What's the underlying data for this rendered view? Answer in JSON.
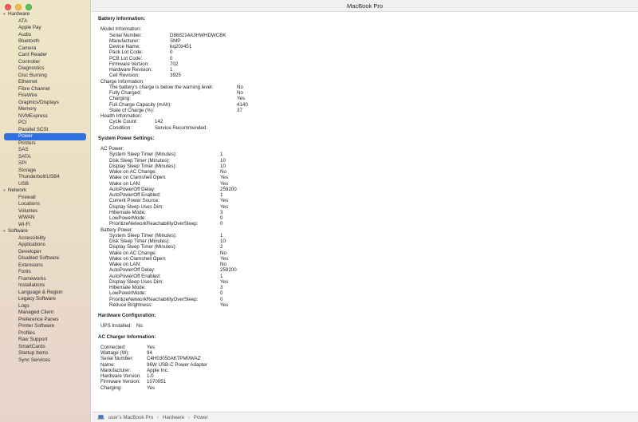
{
  "window": {
    "title": "MacBook Pro"
  },
  "sidebar": {
    "groups": [
      {
        "label": "Hardware",
        "items": [
          "ATA",
          "Apple Pay",
          "Audio",
          "Bluetooth",
          "Camera",
          "Card Reader",
          "Controller",
          "Diagnostics",
          "Disc Burning",
          "Ethernet",
          "Fibre Channel",
          "FireWire",
          "Graphics/Displays",
          "Memory",
          "NVMExpress",
          "PCI",
          "Parallel SCSI",
          "Power",
          "Printers",
          "SAS",
          "SATA",
          "SPI",
          "Storage",
          "Thunderbolt/USB4",
          "USB"
        ]
      },
      {
        "label": "Network",
        "items": [
          "Firewall",
          "Locations",
          "Volumes",
          "WWAN",
          "Wi-Fi"
        ]
      },
      {
        "label": "Software",
        "items": [
          "Accessibility",
          "Applications",
          "Developer",
          "Disabled Software",
          "Extensions",
          "Fonts",
          "Frameworks",
          "Installations",
          "Language & Region",
          "Legacy Software",
          "Logs",
          "Managed Client",
          "Preference Panes",
          "Printer Software",
          "Profiles",
          "Raw Support",
          "SmartCards",
          "Startup Items",
          "Sync Services"
        ]
      }
    ],
    "selected": "Power"
  },
  "content": {
    "sections": [
      {
        "type": "heading",
        "text": "Battery Information:",
        "indent": 0,
        "gap": 0
      },
      {
        "type": "sub",
        "text": "Model Information:",
        "indent": 1,
        "gap": 6
      },
      {
        "type": "kv",
        "key": "Serial Number:",
        "value": "D868214A3HWHDWCBK",
        "indent": 2,
        "col": 76
      },
      {
        "type": "kv",
        "key": "Manufacturer:",
        "value": "SMP",
        "indent": 2,
        "col": 76
      },
      {
        "type": "kv",
        "key": "Device Name:",
        "value": "bq20z451",
        "indent": 2,
        "col": 76
      },
      {
        "type": "kv",
        "key": "Pack Lot Code:",
        "value": "0",
        "indent": 2,
        "col": 76
      },
      {
        "type": "kv",
        "key": "PCB Lot Code:",
        "value": "0",
        "indent": 2,
        "col": 76
      },
      {
        "type": "kv",
        "key": "Firmware Version:",
        "value": "702",
        "indent": 2,
        "col": 76
      },
      {
        "type": "kv",
        "key": "Hardware Revision:",
        "value": "1",
        "indent": 2,
        "col": 76
      },
      {
        "type": "kv",
        "key": "Cell Revision:",
        "value": "3925",
        "indent": 2,
        "col": 76
      },
      {
        "type": "sub",
        "text": "Charge Information:",
        "indent": 1
      },
      {
        "type": "kv",
        "key": "The battery’s charge is below the warning level:",
        "value": "No",
        "indent": 2,
        "col": 160
      },
      {
        "type": "kv",
        "key": "Fully Charged:",
        "value": "No",
        "indent": 2,
        "col": 160
      },
      {
        "type": "kv",
        "key": "Charging:",
        "value": "Yes",
        "indent": 2,
        "col": 160
      },
      {
        "type": "kv",
        "key": "Full Charge Capacity (mAh):",
        "value": "4140",
        "indent": 2,
        "col": 160
      },
      {
        "type": "kv",
        "key": "State of Charge (%):",
        "value": "37",
        "indent": 2,
        "col": 160
      },
      {
        "type": "sub",
        "text": "Health Information:",
        "indent": 1
      },
      {
        "type": "kv",
        "key": "Cycle Count:",
        "value": "142",
        "indent": 2,
        "col": 57
      },
      {
        "type": "kv",
        "key": "Condition:",
        "value": "Service Recommended",
        "indent": 2,
        "col": 57
      },
      {
        "type": "heading",
        "text": "System Power Settings:",
        "indent": 0,
        "gap": 6
      },
      {
        "type": "sub",
        "text": "AC Power:",
        "indent": 1,
        "gap": 6
      },
      {
        "type": "kv",
        "key": "System Sleep Timer (Minutes):",
        "value": "1",
        "indent": 2,
        "col": 139
      },
      {
        "type": "kv",
        "key": "Disk Sleep Timer (Minutes):",
        "value": "10",
        "indent": 2,
        "col": 139
      },
      {
        "type": "kv",
        "key": "Display Sleep Timer (Minutes):",
        "value": "10",
        "indent": 2,
        "col": 139
      },
      {
        "type": "kv",
        "key": "Wake on AC Change:",
        "value": "No",
        "indent": 2,
        "col": 139
      },
      {
        "type": "kv",
        "key": "Wake on Clamshell Open:",
        "value": "Yes",
        "indent": 2,
        "col": 139
      },
      {
        "type": "kv",
        "key": "Wake on LAN:",
        "value": "Yes",
        "indent": 2,
        "col": 139
      },
      {
        "type": "kv",
        "key": "AutoPowerOff Delay:",
        "value": "259200",
        "indent": 2,
        "col": 139
      },
      {
        "type": "kv",
        "key": "AutoPowerOff Enabled:",
        "value": "1",
        "indent": 2,
        "col": 139
      },
      {
        "type": "kv",
        "key": "Current Power Source:",
        "value": "Yes",
        "indent": 2,
        "col": 139
      },
      {
        "type": "kv",
        "key": "Display Sleep Uses Dim:",
        "value": "Yes",
        "indent": 2,
        "col": 139
      },
      {
        "type": "kv",
        "key": "Hibernate Mode:",
        "value": "3",
        "indent": 2,
        "col": 139
      },
      {
        "type": "kv",
        "key": "LowPowerMode:",
        "value": "0",
        "indent": 2,
        "col": 139
      },
      {
        "type": "kv",
        "key": "PrioritizeNetworkReachabilityOverSleep:",
        "value": "0",
        "indent": 2,
        "col": 139
      },
      {
        "type": "sub",
        "text": "Battery Power:",
        "indent": 1
      },
      {
        "type": "kv",
        "key": "System Sleep Timer (Minutes):",
        "value": "1",
        "indent": 2,
        "col": 139
      },
      {
        "type": "kv",
        "key": "Disk Sleep Timer (Minutes):",
        "value": "10",
        "indent": 2,
        "col": 139
      },
      {
        "type": "kv",
        "key": "Display Sleep Timer (Minutes):",
        "value": "2",
        "indent": 2,
        "col": 139
      },
      {
        "type": "kv",
        "key": "Wake on AC Change:",
        "value": "No",
        "indent": 2,
        "col": 139
      },
      {
        "type": "kv",
        "key": "Wake on Clamshell Open:",
        "value": "Yes",
        "indent": 2,
        "col": 139
      },
      {
        "type": "kv",
        "key": "Wake on LAN:",
        "value": "No",
        "indent": 2,
        "col": 139
      },
      {
        "type": "kv",
        "key": "AutoPowerOff Delay:",
        "value": "259200",
        "indent": 2,
        "col": 139
      },
      {
        "type": "kv",
        "key": "AutoPowerOff Enabled:",
        "value": "1",
        "indent": 2,
        "col": 139
      },
      {
        "type": "kv",
        "key": "Display Sleep Uses Dim:",
        "value": "Yes",
        "indent": 2,
        "col": 139
      },
      {
        "type": "kv",
        "key": "Hibernate Mode:",
        "value": "3",
        "indent": 2,
        "col": 139
      },
      {
        "type": "kv",
        "key": "LowPowerMode:",
        "value": "0",
        "indent": 2,
        "col": 139
      },
      {
        "type": "kv",
        "key": "PrioritizeNetworkReachabilityOverSleep:",
        "value": "0",
        "indent": 2,
        "col": 139
      },
      {
        "type": "kv",
        "key": "Reduce Brightness:",
        "value": "Yes",
        "indent": 2,
        "col": 139
      },
      {
        "type": "heading",
        "text": "Hardware Configuration:",
        "indent": 0,
        "gap": 6
      },
      {
        "type": "kv",
        "key": "UPS Installed:",
        "value": "No",
        "indent": 1,
        "col": 45,
        "gap": 6
      },
      {
        "type": "heading",
        "text": "AC Charger Information:",
        "indent": 0,
        "gap": 6
      },
      {
        "type": "kv",
        "key": "Connected:",
        "value": "Yes",
        "indent": 1,
        "col": 58,
        "gap": 6
      },
      {
        "type": "kv",
        "key": "Wattage (W):",
        "value": "94",
        "indent": 1,
        "col": 58
      },
      {
        "type": "kv",
        "key": "Serial Number:",
        "value": "C4H03050AK7PM0WAZ",
        "indent": 1,
        "col": 58
      },
      {
        "type": "kv",
        "key": "Name:",
        "value": "96W USB-C Power Adapter",
        "indent": 1,
        "col": 58
      },
      {
        "type": "kv",
        "key": "Manufacturer:",
        "value": "Apple Inc.",
        "indent": 1,
        "col": 58
      },
      {
        "type": "kv",
        "key": "Hardware Version:",
        "value": "1.0",
        "indent": 1,
        "col": 58
      },
      {
        "type": "kv",
        "key": "Firmware Version:",
        "value": "1070051",
        "indent": 1,
        "col": 58
      },
      {
        "type": "kv",
        "key": "Charging:",
        "value": "Yes",
        "indent": 1,
        "col": 58
      }
    ]
  },
  "statusbar": {
    "path": [
      "user’s MacBook Pro",
      "Hardware",
      "Power"
    ],
    "separator": "›"
  },
  "colors": {
    "selection": "#2f6fe0",
    "sidebar_bg": "#efe6c9"
  }
}
